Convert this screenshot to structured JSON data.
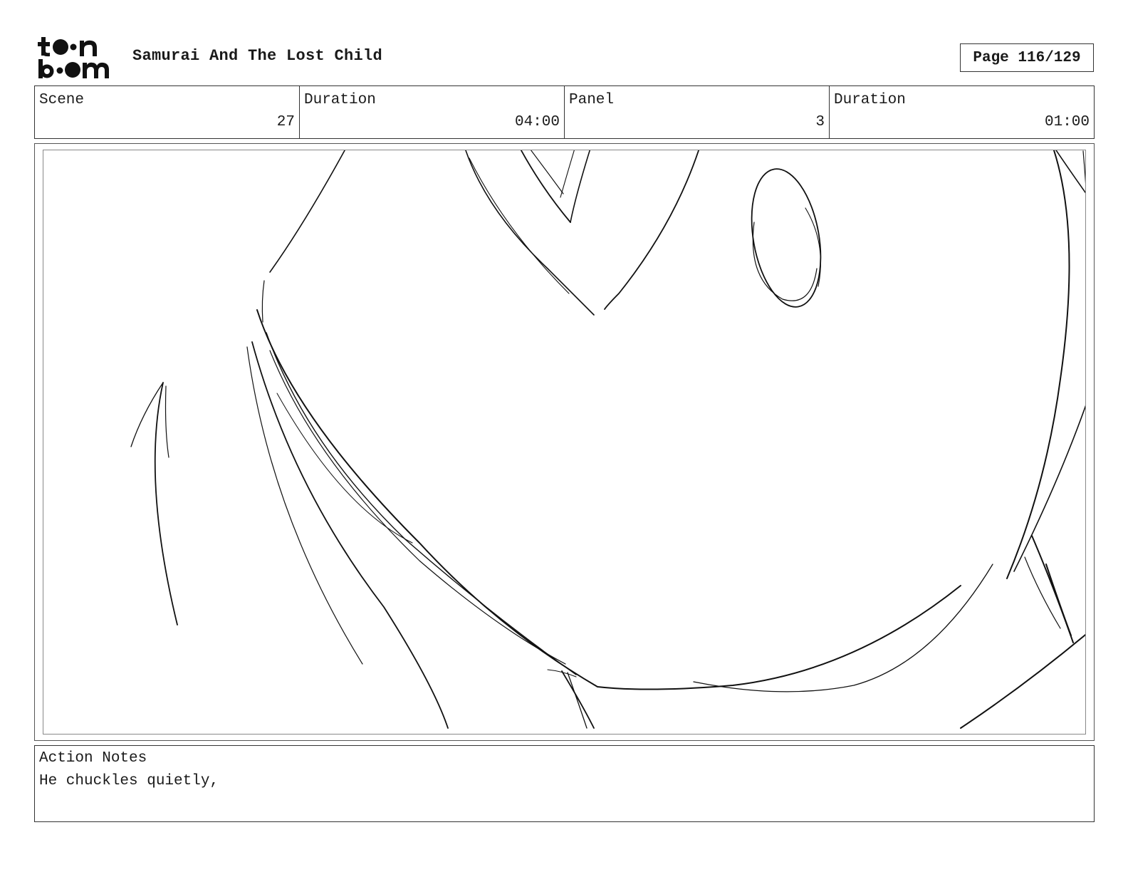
{
  "header": {
    "logo_text": "toon boom",
    "title": "Samurai And The Lost Child",
    "page": "Page 116/129"
  },
  "info": {
    "scene_label": "Scene",
    "scene_value": "27",
    "scene_duration_label": "Duration",
    "scene_duration_value": "04:00",
    "panel_label": "Panel",
    "panel_value": "3",
    "panel_duration_label": "Duration",
    "panel_duration_value": "01:00"
  },
  "notes": {
    "label": "Action Notes",
    "text": "He chuckles quietly,"
  }
}
